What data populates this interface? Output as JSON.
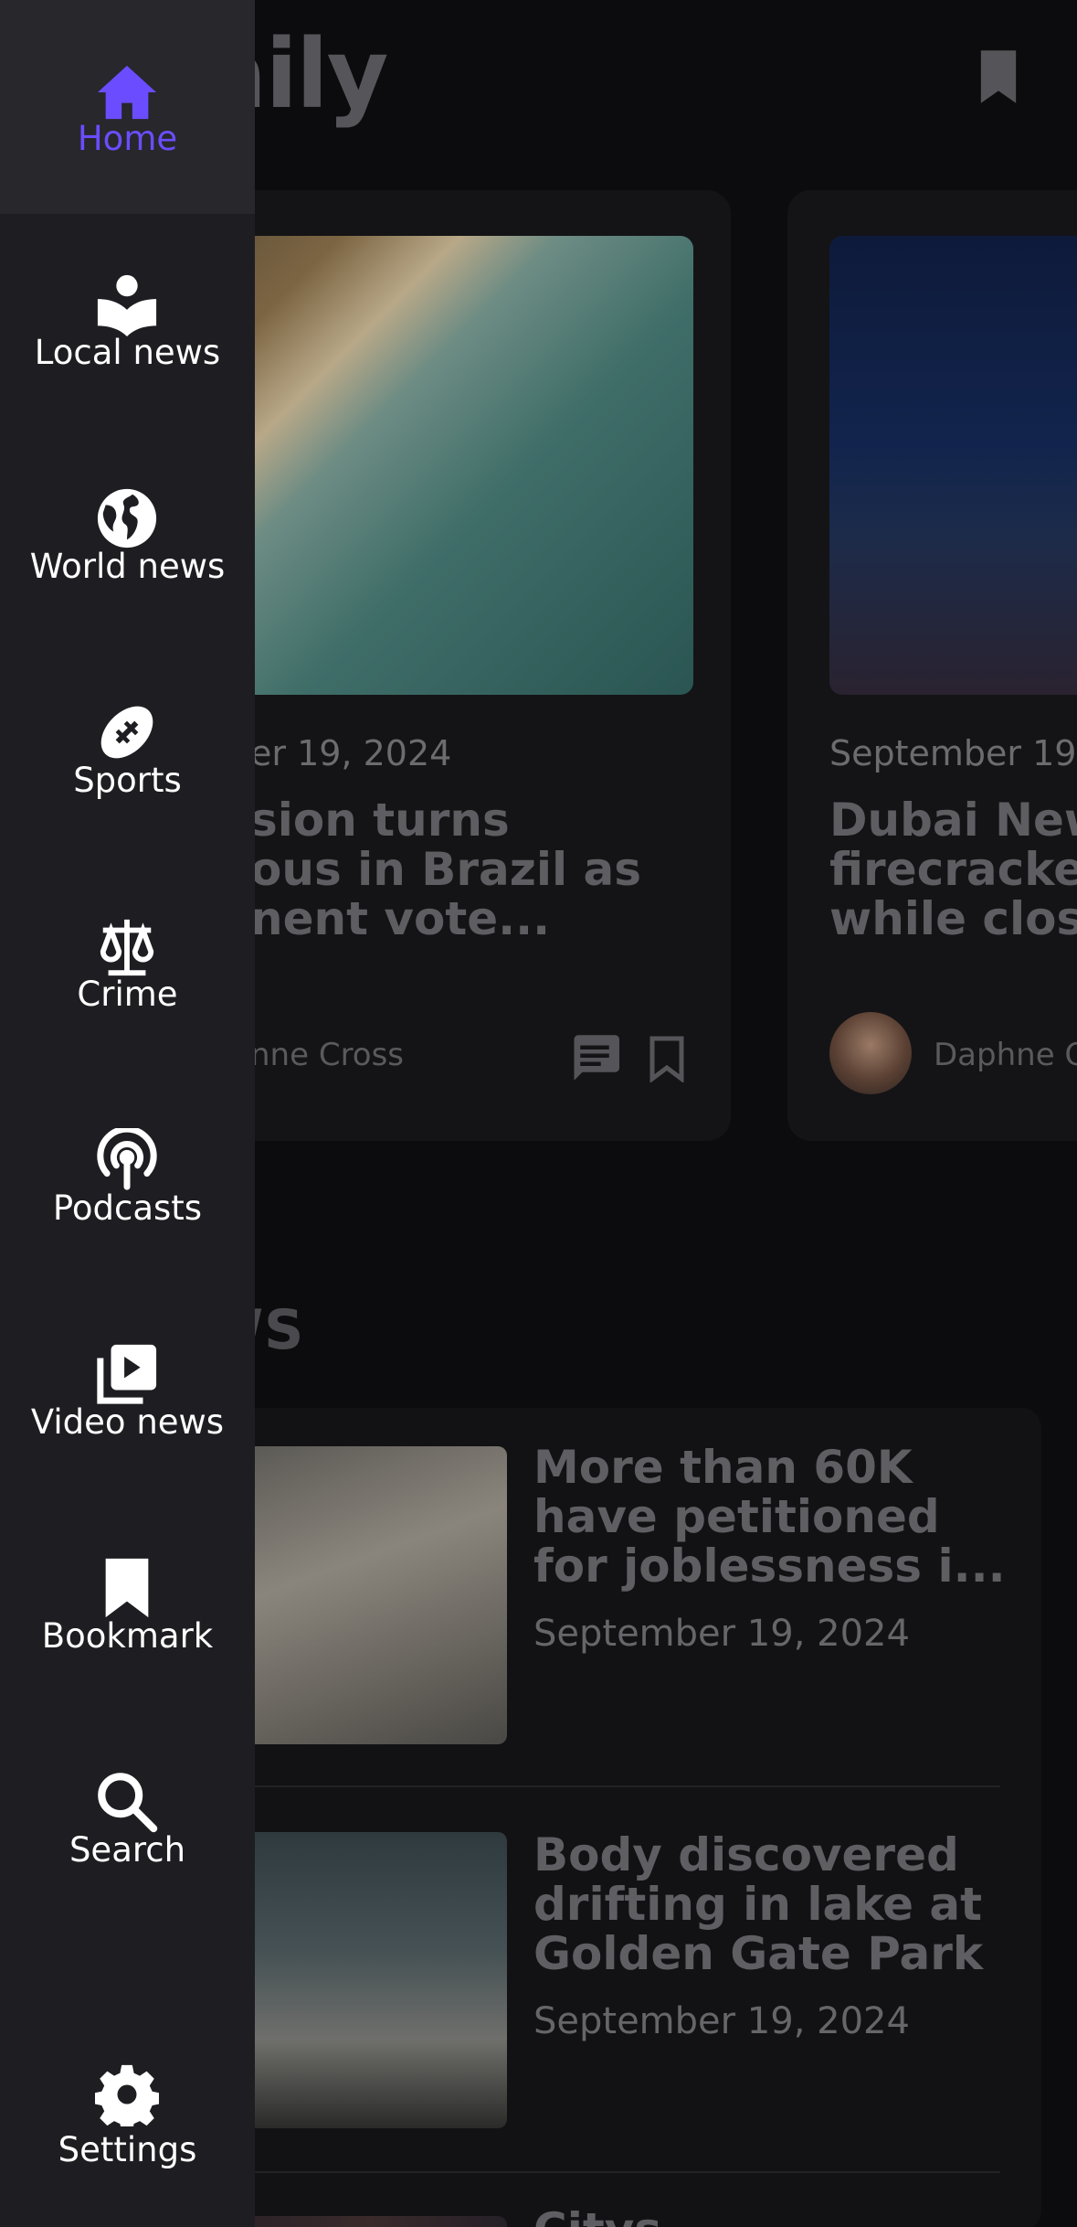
{
  "app": {
    "title_visible": "ver Daily"
  },
  "featured": [
    {
      "date": "er 19, 2024",
      "headline_lines": [
        "sion turns",
        "ous in Brazil as",
        "nent vote..."
      ],
      "author": "nne Cross"
    },
    {
      "date": "September 19",
      "headline_lines": [
        "Dubai New",
        "firecracke",
        "while clos"
      ],
      "author": "Daphne C"
    }
  ],
  "section_title": "EWS",
  "list": [
    {
      "title_lines": [
        "More than 60K",
        "have petitioned",
        "for joblessness i..."
      ],
      "date": "September 19, 2024"
    },
    {
      "title_lines": [
        "Body discovered",
        "drifting in lake at",
        "Golden Gate Park"
      ],
      "date": "September 19, 2024"
    },
    {
      "title_lines": [
        "Citys..."
      ],
      "date": ""
    }
  ],
  "drawer": {
    "items": [
      {
        "label": "Home",
        "icon": "home-icon",
        "active": true
      },
      {
        "label": "Local news",
        "icon": "local-news-icon"
      },
      {
        "label": "World news",
        "icon": "globe-icon"
      },
      {
        "label": "Sports",
        "icon": "football-icon"
      },
      {
        "label": "Crime",
        "icon": "scales-icon"
      },
      {
        "label": "Podcasts",
        "icon": "podcast-icon"
      },
      {
        "label": "Video news",
        "icon": "video-icon"
      },
      {
        "label": "Bookmark",
        "icon": "bookmark-icon"
      },
      {
        "label": "Search",
        "icon": "search-icon"
      },
      {
        "label": "Settings",
        "icon": "gear-icon"
      }
    ]
  },
  "colors": {
    "accent": "#6b4dff",
    "drawer_bg": "#1e1e22",
    "drawer_active_bg": "#27272c"
  }
}
